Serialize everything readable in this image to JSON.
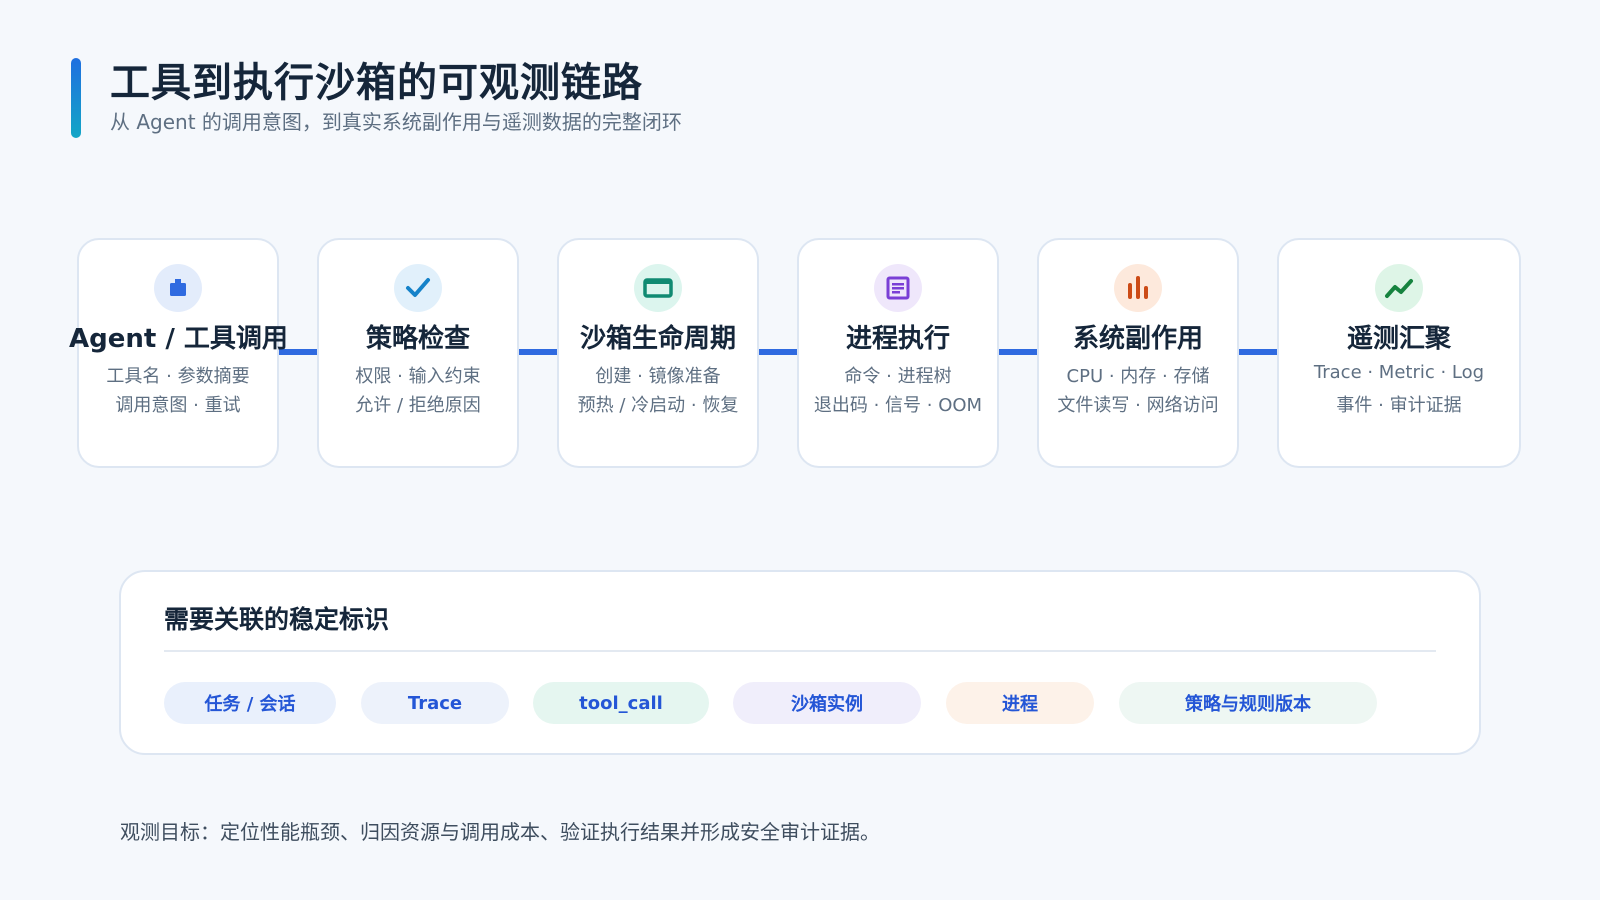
{
  "header": {
    "title": "工具到执行沙箱的可观测链路",
    "subtitle": "从 Agent 的调用意图，到真实系统副作用与遥测数据的完整闭环"
  },
  "stages": [
    {
      "title": "Agent / 工具调用",
      "line1": "工具名 · 参数摘要",
      "line2": "调用意图 · 重试",
      "icon": "robot-icon",
      "icon_bg": "#e3ecfb",
      "icon_color": "#2f6ae0"
    },
    {
      "title": "策略检查",
      "line1": "权限 · 输入约束",
      "line2": "允许 / 拒绝原因",
      "icon": "checkmark-icon",
      "icon_bg": "#e1f0fb",
      "icon_color": "#1582c9"
    },
    {
      "title": "沙箱生命周期",
      "line1": "创建 · 镜像准备",
      "line2": "预热 / 冷启动 · 恢复",
      "icon": "container-icon",
      "icon_bg": "#dcf5ee",
      "icon_color": "#108a72"
    },
    {
      "title": "进程执行",
      "line1": "命令 · 进程树",
      "line2": "退出码 · 信号 · OOM",
      "icon": "document-icon",
      "icon_bg": "#efe7fb",
      "icon_color": "#7a3fd6"
    },
    {
      "title": "系统副作用",
      "line1": "CPU · 内存 · 存储",
      "line2": "文件读写 · 网络访问",
      "icon": "bar-chart-icon",
      "icon_bg": "#fde9dc",
      "icon_color": "#cc4b16"
    },
    {
      "title": "遥测汇聚",
      "line1": "Trace · Metric · Log",
      "line2": "事件 · 审计证据",
      "icon": "trend-icon",
      "icon_bg": "#def5e7",
      "icon_color": "#16833f"
    }
  ],
  "ids_panel": {
    "title": "需要关联的稳定标识",
    "chips": [
      {
        "label": "任务 / 会话",
        "bg": "#e9f0fc"
      },
      {
        "label": "Trace",
        "bg": "#edf2fb"
      },
      {
        "label": "tool_call",
        "bg": "#e5f6f0"
      },
      {
        "label": "沙箱实例",
        "bg": "#f0eefb"
      },
      {
        "label": "进程",
        "bg": "#fdf2e9"
      },
      {
        "label": "策略与规则版本",
        "bg": "#eef7f3"
      }
    ]
  },
  "footer": {
    "note": "观测目标：定位性能瓶颈、归因资源与调用成本、验证执行结果并形成安全审计证据。"
  }
}
